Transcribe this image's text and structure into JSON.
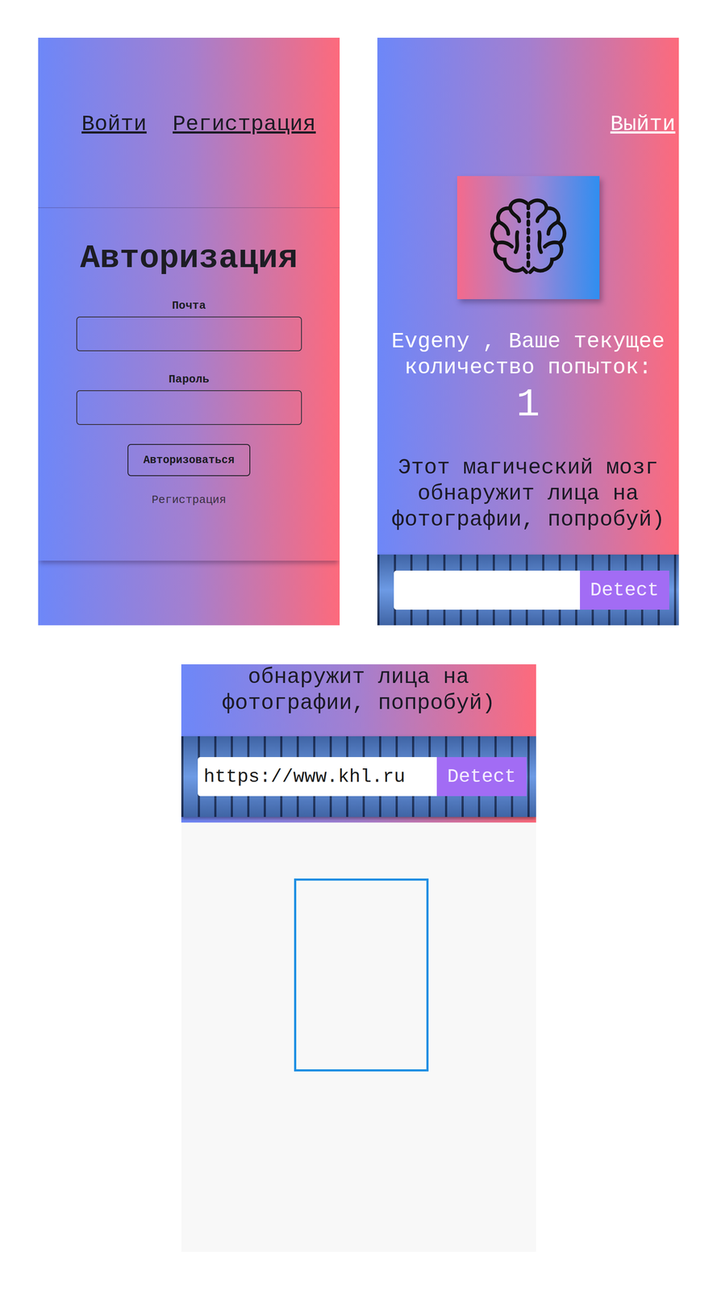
{
  "login_screen": {
    "nav": [
      {
        "label": "Войти"
      },
      {
        "label": "Регистрация"
      }
    ],
    "title": "Авторизация",
    "fields": [
      {
        "label": "Почта",
        "value": "",
        "kind": "text"
      },
      {
        "label": "Пароль",
        "value": "",
        "kind": "password"
      }
    ],
    "submit_button": "Авторизоваться",
    "register_link": "Регистрация"
  },
  "detect_screen": {
    "logout_link": "Выйти",
    "greeting": "Evgeny , Ваше текущее количество попыток:",
    "attempts": "1",
    "description": "Этот магический мозг обнаружит лица на фотографии, попробуй)",
    "url_input": {
      "value": ""
    },
    "detect_button": "Detect"
  },
  "result_screen": {
    "description": "обнаружит лица на фотографии, попробуй)",
    "url_input": {
      "value": "https://www.khl.ru"
    },
    "detect_button": "Detect"
  }
}
